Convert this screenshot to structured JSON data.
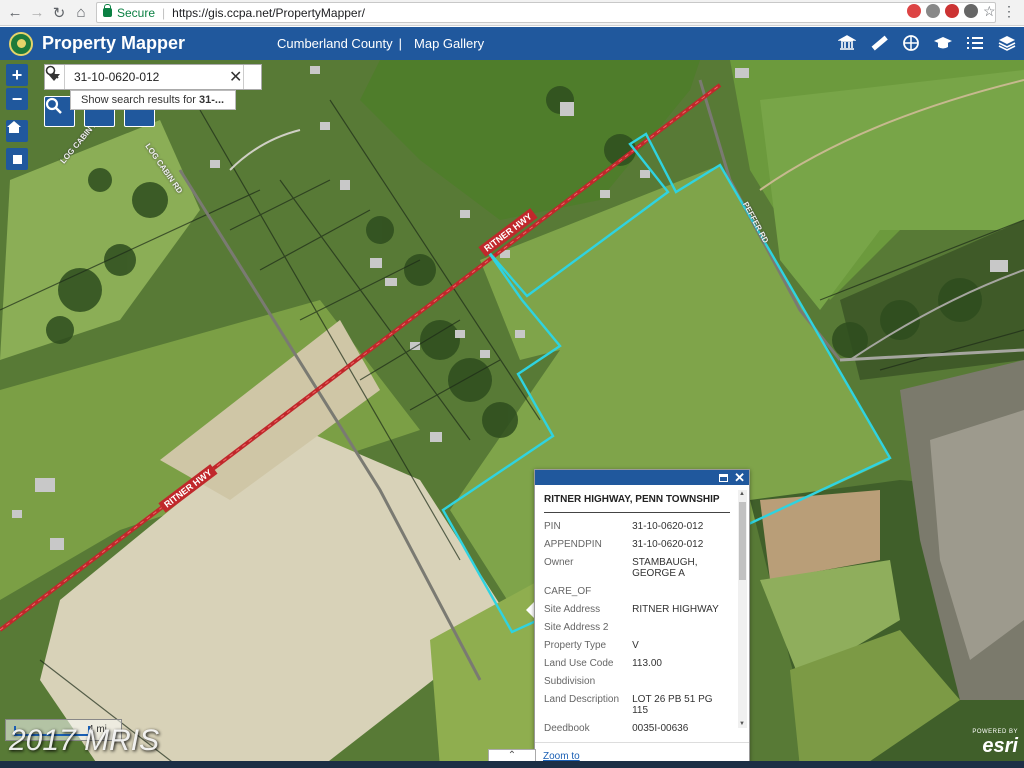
{
  "browser": {
    "secure_label": "Secure",
    "url_host": "https://gis.ccpa.net",
    "url_path": "/PropertyMapper/"
  },
  "app": {
    "title": "Property Mapper",
    "county_link": "Cumberland County",
    "gallery_link": "Map Gallery",
    "toolbar": [
      "museum-icon",
      "ruler-icon",
      "layers-toggle-icon",
      "graduation-cap-icon",
      "list-icon",
      "stack-icon"
    ]
  },
  "search": {
    "value": "31-10-0620-012",
    "suggestion_prefix": "Show search results for ",
    "suggestion_term": "31-..."
  },
  "map": {
    "road_labels": [
      "RITNER HWY",
      "RITNER HWY"
    ],
    "side_labels": [
      "LOG CABIN RD",
      "LOG CABIN RD",
      "PEFFER RD"
    ],
    "scale_text": "4 mi",
    "watermark": "2017 MRIS",
    "attribution_small": "POWERED BY",
    "attribution": "esri"
  },
  "popup": {
    "title": "RITNER HIGHWAY, PENN TOWNSHIP",
    "fields": [
      {
        "key": "PIN",
        "value": "31-10-0620-012"
      },
      {
        "key": "APPENDPIN",
        "value": "31-10-0620-012"
      },
      {
        "key": "Owner",
        "value": "STAMBAUGH, GEORGE A"
      },
      {
        "key": "CARE_OF",
        "value": ""
      },
      {
        "key": "Site Address",
        "value": "RITNER HIGHWAY"
      },
      {
        "key": "Site Address 2",
        "value": ""
      },
      {
        "key": "Property Type",
        "value": "V"
      },
      {
        "key": "Land Use Code",
        "value": "113.00"
      },
      {
        "key": "Subdivision",
        "value": ""
      },
      {
        "key": "Land Description",
        "value": "LOT 26 PB 51 PG 115"
      },
      {
        "key": "Deedbook",
        "value": "0035I-00636"
      }
    ],
    "zoom_link": "Zoom to"
  },
  "colors": {
    "header": "#20589d",
    "parcel_outline": "#2fd3e0",
    "road": "#c0282b"
  }
}
